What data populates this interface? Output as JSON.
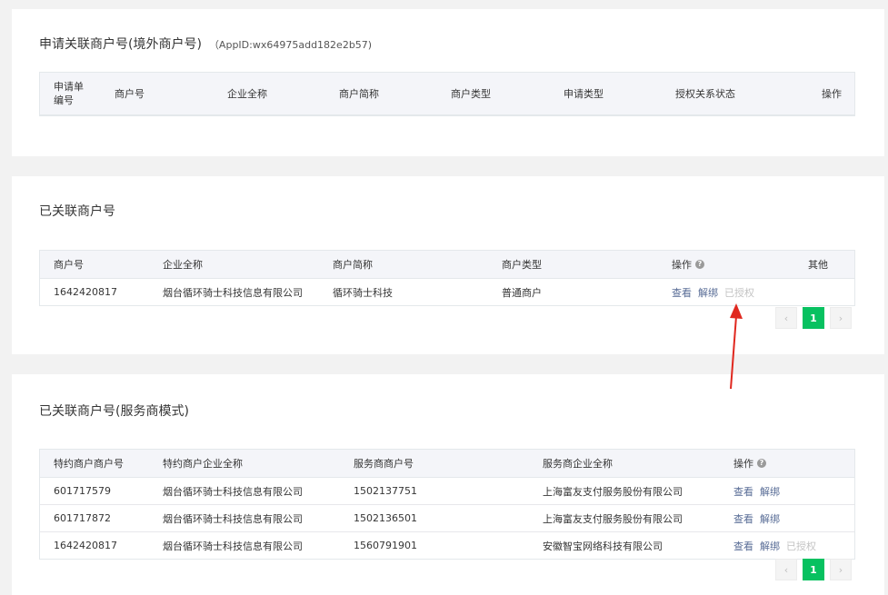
{
  "pending_section": {
    "title": "申请关联商户号(境外商户号)",
    "appid": "（AppID:wx64975add182e2b57)",
    "columns": [
      "申请单\n编号",
      "商户号",
      "企业全称",
      "商户简称",
      "商户类型",
      "申请类型",
      "授权关系状态",
      "操作"
    ]
  },
  "linked_section": {
    "title": "已关联商户号",
    "columns": [
      "商户号",
      "企业全称",
      "商户简称",
      "商户类型",
      "操作",
      "其他"
    ],
    "rows": [
      {
        "merchant_id": "1642420817",
        "company": "烟台循环骑士科技信息有限公司",
        "short_name": "循环骑士科技",
        "type": "普通商户",
        "action_view": "查看",
        "action_unbind": "解绑",
        "action_authorized": "已授权"
      }
    ],
    "pagination": {
      "prev": "‹",
      "page": "1",
      "next": "›"
    }
  },
  "service_section": {
    "title": "已关联商户号(服务商模式)",
    "columns": [
      "特约商户商户号",
      "特约商户企业全称",
      "服务商商户号",
      "服务商企业全称",
      "操作"
    ],
    "rows": [
      {
        "sub_merchant_id": "601717579",
        "sub_company": "烟台循环骑士科技信息有限公司",
        "sp_merchant_id": "1502137751",
        "sp_company": "上海富友支付服务股份有限公司",
        "action_view": "查看",
        "action_unbind": "解绑",
        "action_authorized": ""
      },
      {
        "sub_merchant_id": "601717872",
        "sub_company": "烟台循环骑士科技信息有限公司",
        "sp_merchant_id": "1502136501",
        "sp_company": "上海富友支付服务股份有限公司",
        "action_view": "查看",
        "action_unbind": "解绑",
        "action_authorized": ""
      },
      {
        "sub_merchant_id": "1642420817",
        "sub_company": "烟台循环骑士科技信息有限公司",
        "sp_merchant_id": "1560791901",
        "sp_company": "安徽智宝网络科技有限公司",
        "action_view": "查看",
        "action_unbind": "解绑",
        "action_authorized": "已授权"
      }
    ],
    "pagination": {
      "prev": "‹",
      "page": "1",
      "next": "›"
    }
  },
  "help_icon_glyph": "?",
  "colors": {
    "accent": "#07c160",
    "link": "#576b95",
    "annotation": "#e0281f"
  }
}
